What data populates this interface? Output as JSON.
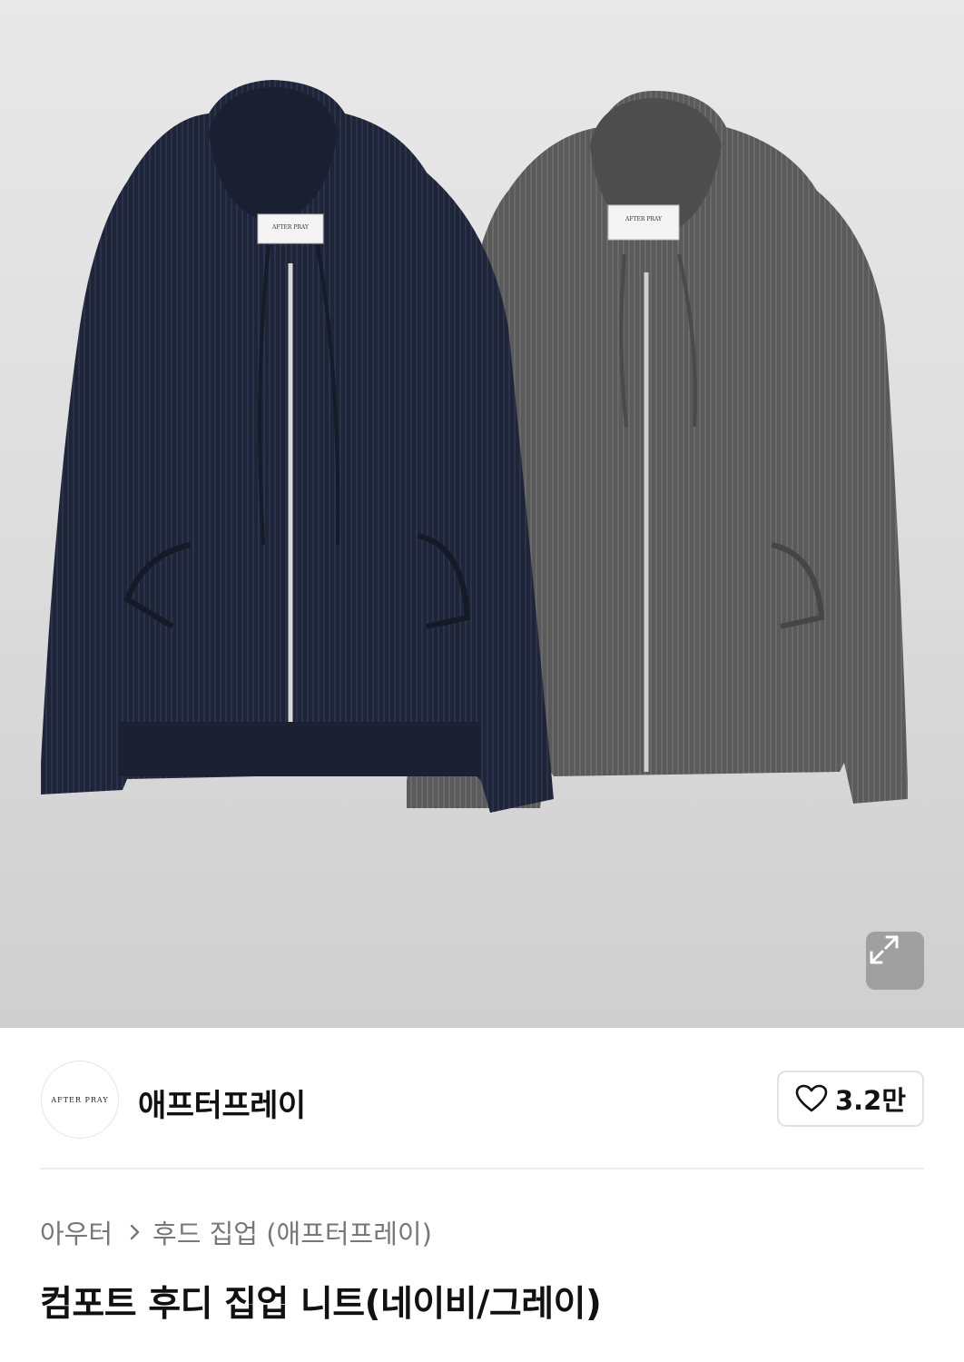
{
  "hero": {
    "image_alt": "컴포트 후디 집업 니트(네이비/그레이)",
    "garment_colors": [
      "#1f2538",
      "#5a5a5a"
    ],
    "label_text": "AFTER PRAY",
    "expand_icon": "expand-arrows-icon"
  },
  "brand": {
    "logo_text": "AFTER PRAY",
    "name": "애프터프레이"
  },
  "like": {
    "icon": "heart-outline-icon",
    "count": "3.2만"
  },
  "breadcrumb": {
    "category": "아우터",
    "separator_icon": "chevron-right-icon",
    "subcategory": "후드 집업 (애프터프레이)"
  },
  "product": {
    "title": "컴포트 후디 집업 니트(네이비/그레이)"
  },
  "colors": {
    "navy": "#1f2538",
    "gray": "#5a5a5a",
    "muted_text": "#777777",
    "border": "#e2e2e2"
  }
}
